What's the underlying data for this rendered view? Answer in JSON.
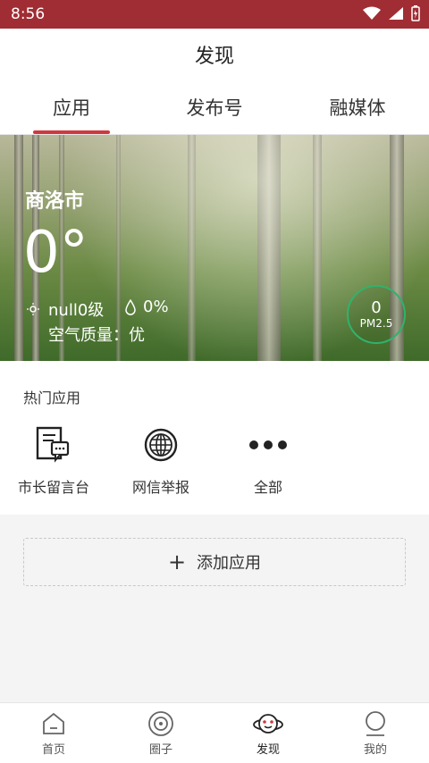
{
  "status": {
    "time": "8:56"
  },
  "header": {
    "title": "发现"
  },
  "tabs": [
    {
      "label": "应用"
    },
    {
      "label": "发布号"
    },
    {
      "label": "融媒体"
    }
  ],
  "weather": {
    "city": "商洛市",
    "temperature": "0°",
    "wind": "null0级",
    "humidity": "0%",
    "air_quality": "空气质量：优",
    "pm_value": "0",
    "pm_label": "PM2.5"
  },
  "hot_apps": {
    "title": "热门应用",
    "items": [
      {
        "label": "市长留言台",
        "icon": "message-board-icon"
      },
      {
        "label": "网信举报",
        "icon": "globe-icon"
      },
      {
        "label": "全部",
        "icon": "more-icon"
      }
    ]
  },
  "add_app": {
    "label": "添加应用"
  },
  "bottom_nav": [
    {
      "label": "首页",
      "icon": "home-icon"
    },
    {
      "label": "圈子",
      "icon": "circle-icon"
    },
    {
      "label": "发现",
      "icon": "discover-icon"
    },
    {
      "label": "我的",
      "icon": "profile-icon"
    }
  ],
  "colors": {
    "status_bar": "#a02d33",
    "accent": "#d0383f",
    "pm_ring": "#2fb36c"
  }
}
